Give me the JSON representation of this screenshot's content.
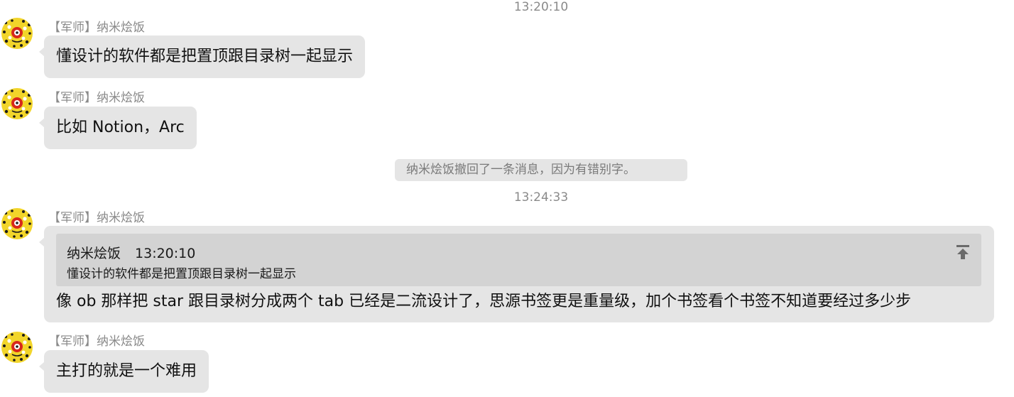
{
  "timestamps": {
    "t1": "13:20:10",
    "t2": "13:24:33"
  },
  "messages": [
    {
      "sender": "【军师】纳米烩饭",
      "text": "懂设计的软件都是把置顶跟目录树一起显示"
    },
    {
      "sender": "【军师】纳米烩饭",
      "text": "比如 Notion，Arc"
    },
    {
      "sender": "【军师】纳米烩饭",
      "text": "主打的就是一个难用"
    }
  ],
  "recall_notice": "纳米烩饭撤回了一条消息，因为有错别字。",
  "reply": {
    "sender": "【军师】纳米烩饭",
    "quote_author": "纳米烩饭",
    "quote_time": "13:20:10",
    "quote_text": "懂设计的软件都是把置顶跟目录树一起显示",
    "text": "像 ob 那样把 star 跟目录树分成两个 tab 已经是二流设计了，思源书签更是重量级，加个书签看个书签不知道要经过多少步"
  },
  "colors": {
    "bubble": "#e5e5e5",
    "quote": "#d3d3d3",
    "meta_text": "#8a8a8a",
    "avatar_bg": "#f2d52a"
  },
  "icons": {
    "avatar": "cartoon-avatar-icon",
    "jump": "jump-to-original-icon"
  }
}
